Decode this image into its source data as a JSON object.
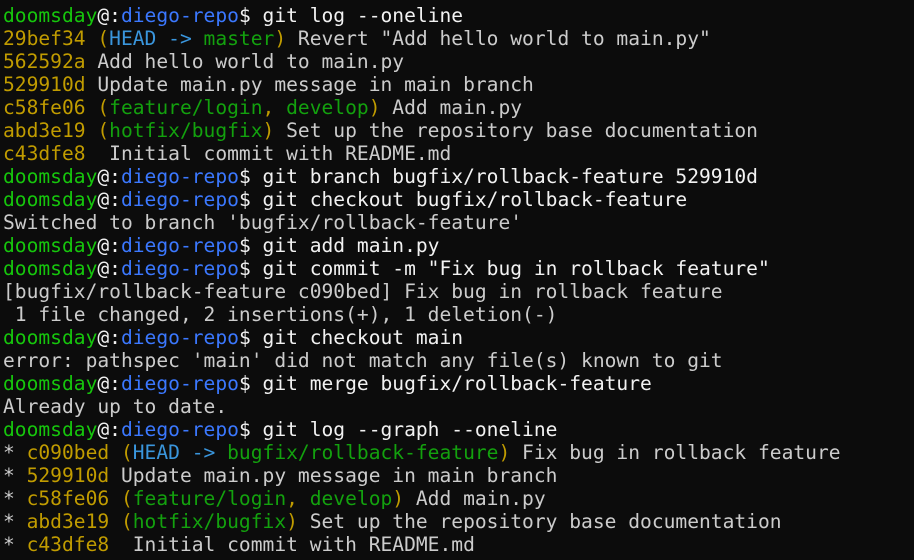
{
  "colors": {
    "background": "#0c0c0c",
    "user_host": "#16c60c",
    "path": "#3b78ff",
    "command": "#f2f2f2",
    "hash": "#c19c00",
    "head_ref": "#3a96dd",
    "branch_ref": "#13a10e",
    "output": "#cccccc"
  },
  "terminal": {
    "lines": [
      {
        "type": "prompt",
        "user": "doomsday",
        "at": "@",
        "sep": ":",
        "path": "diego-repo",
        "dollar": "$ ",
        "command": "git log --oneline"
      },
      {
        "type": "commit",
        "graph": "",
        "hash": "29bef34",
        "refs": [
          {
            "text": " (",
            "kind": "paren"
          },
          {
            "text": "HEAD -> ",
            "kind": "head"
          },
          {
            "text": "master",
            "kind": "branch"
          },
          {
            "text": ")",
            "kind": "paren"
          }
        ],
        "message": " Revert \"Add hello world to main.py\""
      },
      {
        "type": "commit",
        "graph": "",
        "hash": "562592a",
        "refs": [],
        "message": " Add hello world to main.py"
      },
      {
        "type": "commit",
        "graph": "",
        "hash": "529910d",
        "refs": [],
        "message": " Update main.py message in main branch"
      },
      {
        "type": "commit",
        "graph": "",
        "hash": "c58fe06",
        "refs": [
          {
            "text": " (",
            "kind": "paren"
          },
          {
            "text": "feature/login",
            "kind": "branch"
          },
          {
            "text": ", ",
            "kind": "paren"
          },
          {
            "text": "develop",
            "kind": "branch"
          },
          {
            "text": ")",
            "kind": "paren"
          }
        ],
        "message": " Add main.py"
      },
      {
        "type": "commit",
        "graph": "",
        "hash": "abd3e19",
        "refs": [
          {
            "text": " (",
            "kind": "paren"
          },
          {
            "text": "hotfix/bugfix",
            "kind": "branch"
          },
          {
            "text": ")",
            "kind": "paren"
          }
        ],
        "message": " Set up the repository base documentation"
      },
      {
        "type": "commit",
        "graph": "",
        "hash": "c43dfe8",
        "refs": [],
        "message": "  Initial commit with README.md"
      },
      {
        "type": "prompt",
        "user": "doomsday",
        "at": "@",
        "sep": ":",
        "path": "diego-repo",
        "dollar": "$ ",
        "command": "git branch bugfix/rollback-feature 529910d"
      },
      {
        "type": "prompt",
        "user": "doomsday",
        "at": "@",
        "sep": ":",
        "path": "diego-repo",
        "dollar": "$ ",
        "command": "git checkout bugfix/rollback-feature"
      },
      {
        "type": "output",
        "text": "Switched to branch 'bugfix/rollback-feature'"
      },
      {
        "type": "prompt",
        "user": "doomsday",
        "at": "@",
        "sep": ":",
        "path": "diego-repo",
        "dollar": "$ ",
        "command": "git add main.py"
      },
      {
        "type": "prompt",
        "user": "doomsday",
        "at": "@",
        "sep": ":",
        "path": "diego-repo",
        "dollar": "$ ",
        "command": "git commit -m \"Fix bug in rollback feature\""
      },
      {
        "type": "output",
        "text": "[bugfix/rollback-feature c090bed] Fix bug in rollback feature"
      },
      {
        "type": "output",
        "text": " 1 file changed, 2 insertions(+), 1 deletion(-)"
      },
      {
        "type": "prompt",
        "user": "doomsday",
        "at": "@",
        "sep": ":",
        "path": "diego-repo",
        "dollar": "$ ",
        "command": "git checkout main"
      },
      {
        "type": "output",
        "text": "error: pathspec 'main' did not match any file(s) known to git"
      },
      {
        "type": "prompt",
        "user": "doomsday",
        "at": "@",
        "sep": ":",
        "path": "diego-repo",
        "dollar": "$ ",
        "command": "git merge bugfix/rollback-feature"
      },
      {
        "type": "output",
        "text": "Already up to date."
      },
      {
        "type": "prompt",
        "user": "doomsday",
        "at": "@",
        "sep": ":",
        "path": "diego-repo",
        "dollar": "$ ",
        "command": "git log --graph --oneline"
      },
      {
        "type": "commit",
        "graph": "* ",
        "hash": "c090bed",
        "refs": [
          {
            "text": " (",
            "kind": "paren"
          },
          {
            "text": "HEAD -> ",
            "kind": "head"
          },
          {
            "text": "bugfix/rollback-feature",
            "kind": "branch"
          },
          {
            "text": ")",
            "kind": "paren"
          }
        ],
        "message": " Fix bug in rollback feature"
      },
      {
        "type": "commit",
        "graph": "* ",
        "hash": "529910d",
        "refs": [],
        "message": " Update main.py message in main branch"
      },
      {
        "type": "commit",
        "graph": "* ",
        "hash": "c58fe06",
        "refs": [
          {
            "text": " (",
            "kind": "paren"
          },
          {
            "text": "feature/login",
            "kind": "branch"
          },
          {
            "text": ", ",
            "kind": "paren"
          },
          {
            "text": "develop",
            "kind": "branch"
          },
          {
            "text": ")",
            "kind": "paren"
          }
        ],
        "message": " Add main.py"
      },
      {
        "type": "commit",
        "graph": "* ",
        "hash": "abd3e19",
        "refs": [
          {
            "text": " (",
            "kind": "paren"
          },
          {
            "text": "hotfix/bugfix",
            "kind": "branch"
          },
          {
            "text": ")",
            "kind": "paren"
          }
        ],
        "message": " Set up the repository base documentation"
      },
      {
        "type": "commit",
        "graph": "* ",
        "hash": "c43dfe8",
        "refs": [],
        "message": "  Initial commit with README.md"
      }
    ]
  }
}
